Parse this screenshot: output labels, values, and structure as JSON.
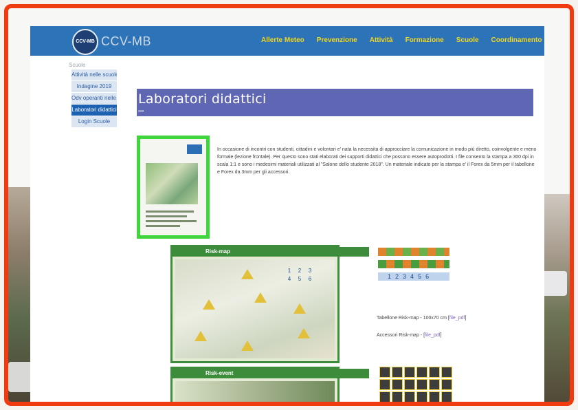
{
  "site": {
    "logo_badge": "CCV-MB",
    "logo_text": "CCV-MB",
    "menu": [
      "Allerte Meteo",
      "Prevenzione",
      "Attività",
      "Formazione",
      "Scuole",
      "Coordinamento"
    ]
  },
  "breadcrumb": "Scuole",
  "sidebar": {
    "items": [
      {
        "label": "Attività nelle scuole"
      },
      {
        "label": "Indagine 2019"
      },
      {
        "label": "Odv operanti nelle scuole"
      },
      {
        "label": "Laboratori didattici",
        "active": true
      },
      {
        "label": "Login Scuole"
      }
    ]
  },
  "page": {
    "title": "Laboratori didattici",
    "title_dots": "•••",
    "intro": "In occasione di incontri con studenti, cittadini e volontari e' nata la necessita di approcciare la comunicazione in modo più diretto, coinvolgente e meno formale (lezione frontale). Per questo sono stati elaborati dei supporti didattici che possono essere autoprodotti. I file consento la stampa a 300 dpi in scala 1:1 e sono i medesimi materiali utilizzati al \"Salone dello studente 2018\". Un materiale indicato per la stampa e' il Forex da 5mm per il tabellone e Forex da 3mm per gli accessori."
  },
  "cards": {
    "risk_map_title": "Risk-map",
    "risk_event_title": "Risk-event",
    "tile_numbers": [
      "1",
      "2",
      "3",
      "4",
      "5",
      "6"
    ],
    "strip_numbers": [
      "1",
      "2",
      "3",
      "4",
      "5",
      "6"
    ]
  },
  "downloads": {
    "board_label": "Tabellone Risk-map - 100x70 cm [",
    "board_link": "file_pdf",
    "board_close": "]",
    "acc_label": "Accessori Risk-map - [",
    "acc_link": "file_pdf",
    "acc_close": "]"
  },
  "colors": {
    "frame": "#f23a11",
    "header": "#2d73b7",
    "menu_text": "#f5d61b",
    "title_bar": "#5f66b4",
    "sidebar_active": "#1d62b2",
    "link": "#7b64c6"
  }
}
